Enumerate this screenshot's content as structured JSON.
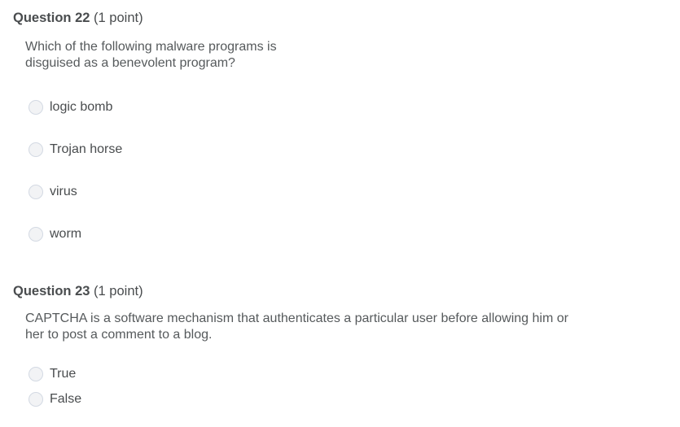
{
  "questions": [
    {
      "number": "Question 22",
      "points": "(1 point)",
      "text_lines": [
        "Which of the following malware programs is",
        "disguised as a benevolent program?"
      ],
      "options": [
        "logic bomb",
        "Trojan horse",
        "virus",
        "worm"
      ],
      "selected": null
    },
    {
      "number": "Question 23",
      "points": "(1 point)",
      "text_lines": [
        "CAPTCHA is a software mechanism that authenticates a particular user before allowing him or",
        "her to post a comment to a blog."
      ],
      "options": [
        "True",
        "False"
      ],
      "selected": null
    }
  ]
}
